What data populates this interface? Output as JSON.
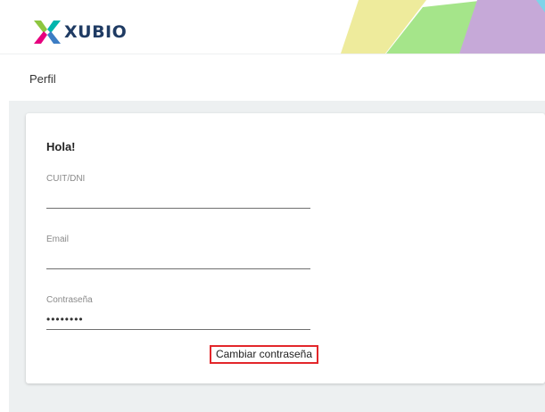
{
  "brand": {
    "name": "XUBIO"
  },
  "header": {
    "page_title": "Perfil"
  },
  "profile_form": {
    "greeting": "Hola!",
    "cuit": {
      "label": "CUIT/DNI",
      "value": ""
    },
    "email": {
      "label": "Email",
      "value": ""
    },
    "password": {
      "label": "Contraseña",
      "value": "••••••••"
    },
    "change_password_label": "Cambiar contraseña"
  },
  "colors": {
    "brand_text": "#1f3b63",
    "logo_green": "#8dc63f",
    "logo_teal": "#00b5ad",
    "logo_magenta": "#e6007e",
    "banner_yellow": "#eeeb9c",
    "banner_green": "#a5e58a",
    "banner_purple": "#c6a9d8",
    "highlight_border": "#e3262a",
    "content_background": "#edf0f1"
  }
}
